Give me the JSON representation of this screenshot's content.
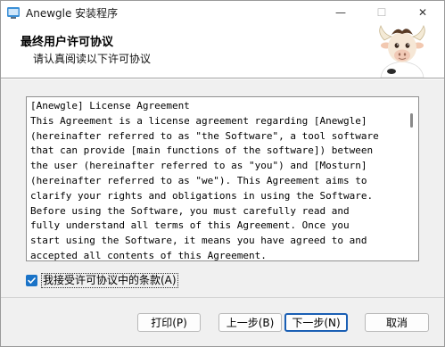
{
  "window": {
    "title": "Anewgle 安装程序",
    "minimize_glyph": "—",
    "maximize_glyph": "☐",
    "close_glyph": "✕",
    "app_icon": "installer-icon"
  },
  "header": {
    "title": "最终用户许可协议",
    "subtitle": "请认真阅读以下许可协议",
    "mascot": "bull-mascot-image"
  },
  "license": {
    "lines": [
      "[Anewgle] License Agreement",
      "This Agreement is a license agreement regarding [Anewgle]",
      "(hereinafter referred to as \"the Software\", a tool software",
      "that can provide [main functions of the software]) between",
      "the user (hereinafter referred to as \"you\") and [Mosturn]",
      "(hereinafter referred to as \"we\"). This Agreement aims to",
      "clarify your rights and obligations in using the Software.",
      "Before using the Software, you must carefully read and",
      "fully understand all terms of this Agreement. Once you",
      "start using the Software, it means you have agreed to and",
      "accepted all contents of this Agreement."
    ]
  },
  "accept": {
    "label": "我接受许可协议中的条款(A)",
    "checked": true
  },
  "buttons": {
    "print": "打印(P)",
    "back": "上一步(B)",
    "next": "下一步(N)",
    "cancel": "取消"
  },
  "colors": {
    "accent": "#1a73c7",
    "default_button_border": "#1a5fb4"
  }
}
